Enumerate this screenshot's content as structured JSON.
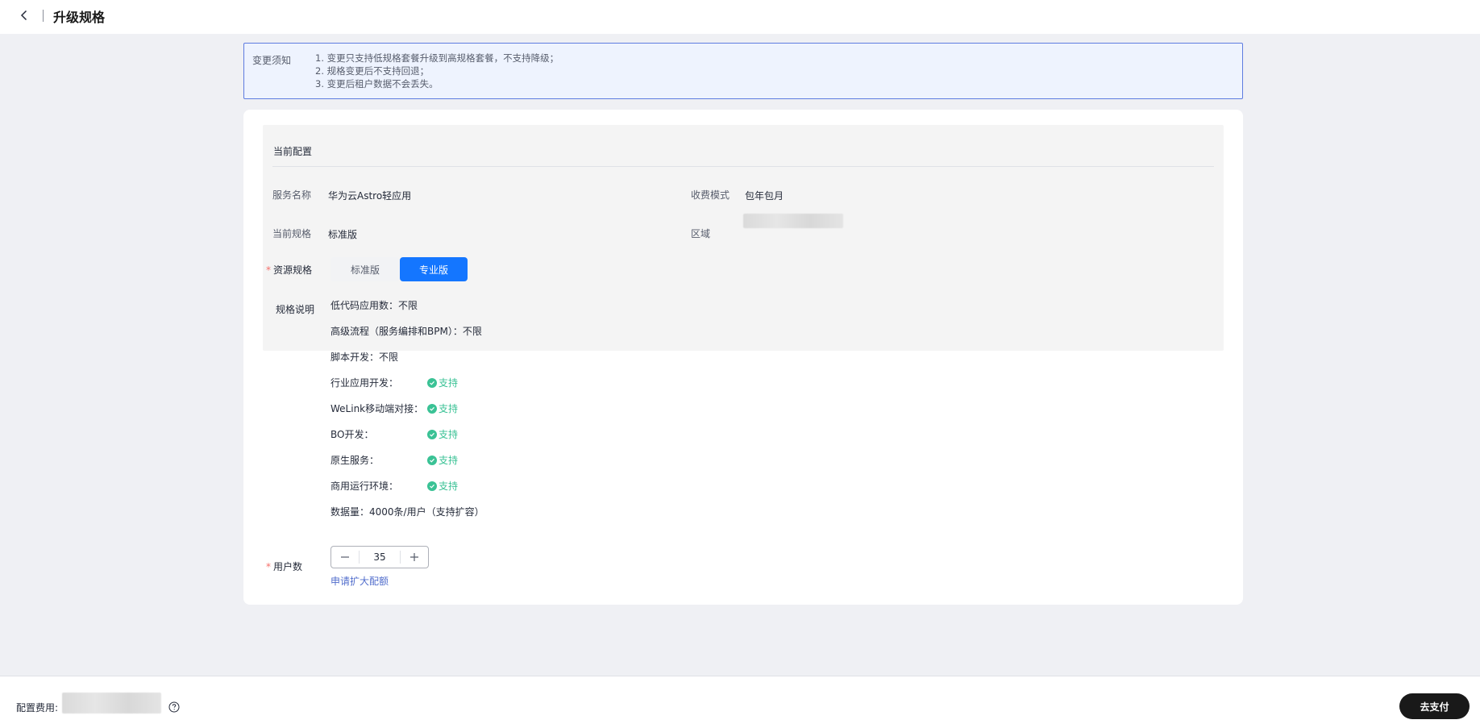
{
  "header": {
    "title": "升级规格",
    "back_icon": "chevron-left-icon"
  },
  "notice": {
    "label": "变更须知",
    "items": [
      "1. 变更只支持低规格套餐升级到高规格套餐，不支持降级；",
      "2. 规格变更后不支持回退；",
      "3. 变更后租户数据不会丢失。"
    ]
  },
  "current_config": {
    "title": "当前配置",
    "service_name_label": "服务名称",
    "service_name_value": "华为云Astro轻应用",
    "billing_mode_label": "收费模式",
    "billing_mode_value": "包年包月",
    "current_spec_label": "当前规格",
    "current_spec_value": "标准版",
    "region_label": "区域"
  },
  "spec": {
    "label": "资源规格",
    "options": [
      "标准版",
      "专业版"
    ],
    "selected": "专业版"
  },
  "spec_desc": {
    "label": "规格说明",
    "lines": {
      "lowcode": "低代码应用数：不限",
      "advanced_flow": "高级流程（服务编排和BPM）：不限",
      "script": "脚本开发：不限",
      "industry": "行业应用开发：",
      "welink": "WeLink移动端对接：",
      "bo": "BO开发：",
      "native": "原生服务：",
      "commercial": "商用运行环境：",
      "data": "数据量：4000条/用户（支持扩容）"
    },
    "support_text": "支持"
  },
  "users": {
    "label": "用户数",
    "value": "35",
    "expand_link": "申请扩大配额"
  },
  "footer": {
    "fee_label": "配置费用:",
    "pay_button": "去支付"
  },
  "colors": {
    "primary": "#1476ff",
    "success": "#3ac295",
    "required": "#f66f6a",
    "link": "#526ecc",
    "dark_button": "#191919"
  }
}
